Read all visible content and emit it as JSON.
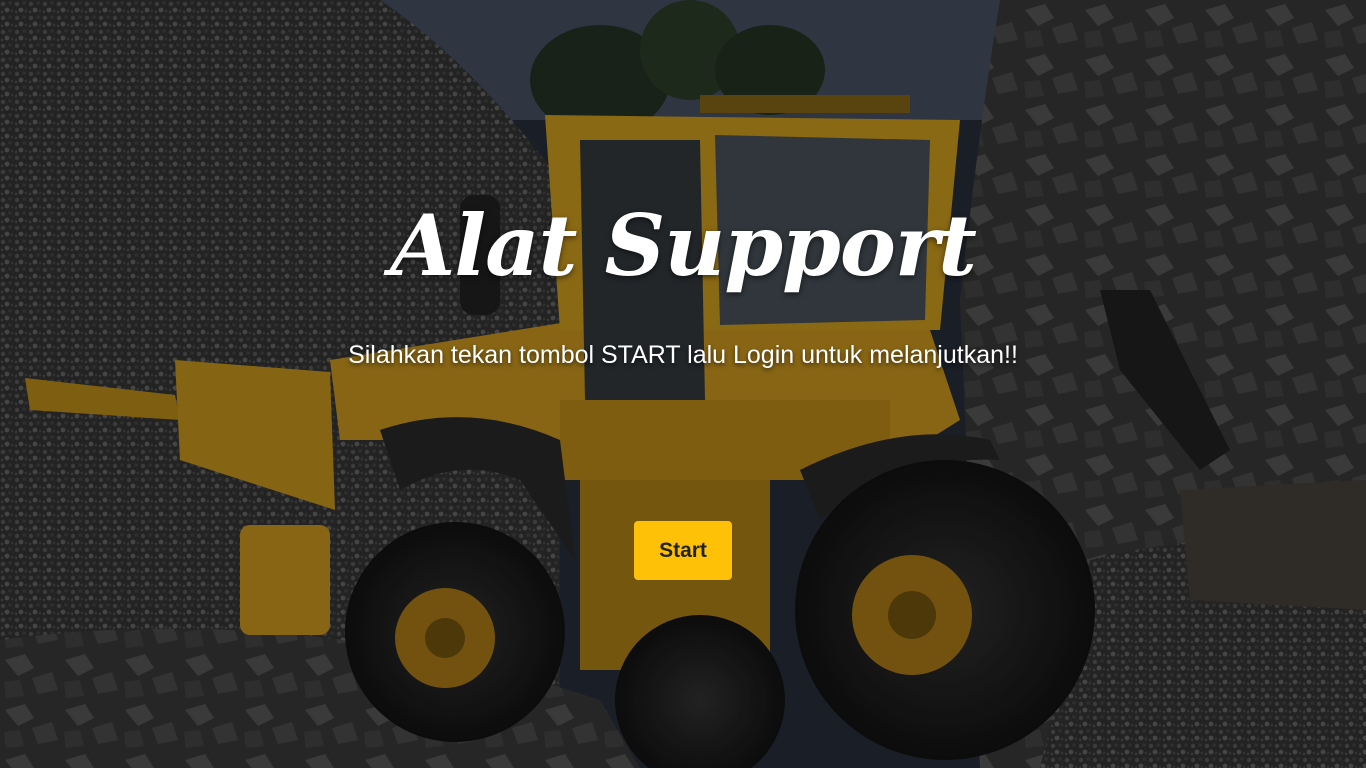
{
  "hero": {
    "title": "Alat Support",
    "subtitle": "Silahkan tekan tombol START lalu Login untuk melanjutkan!!",
    "start_label": "Start"
  },
  "colors": {
    "button_background": "#ffc107",
    "button_text": "#212529",
    "text": "#ffffff",
    "machine_yellow": "#b8860b"
  }
}
